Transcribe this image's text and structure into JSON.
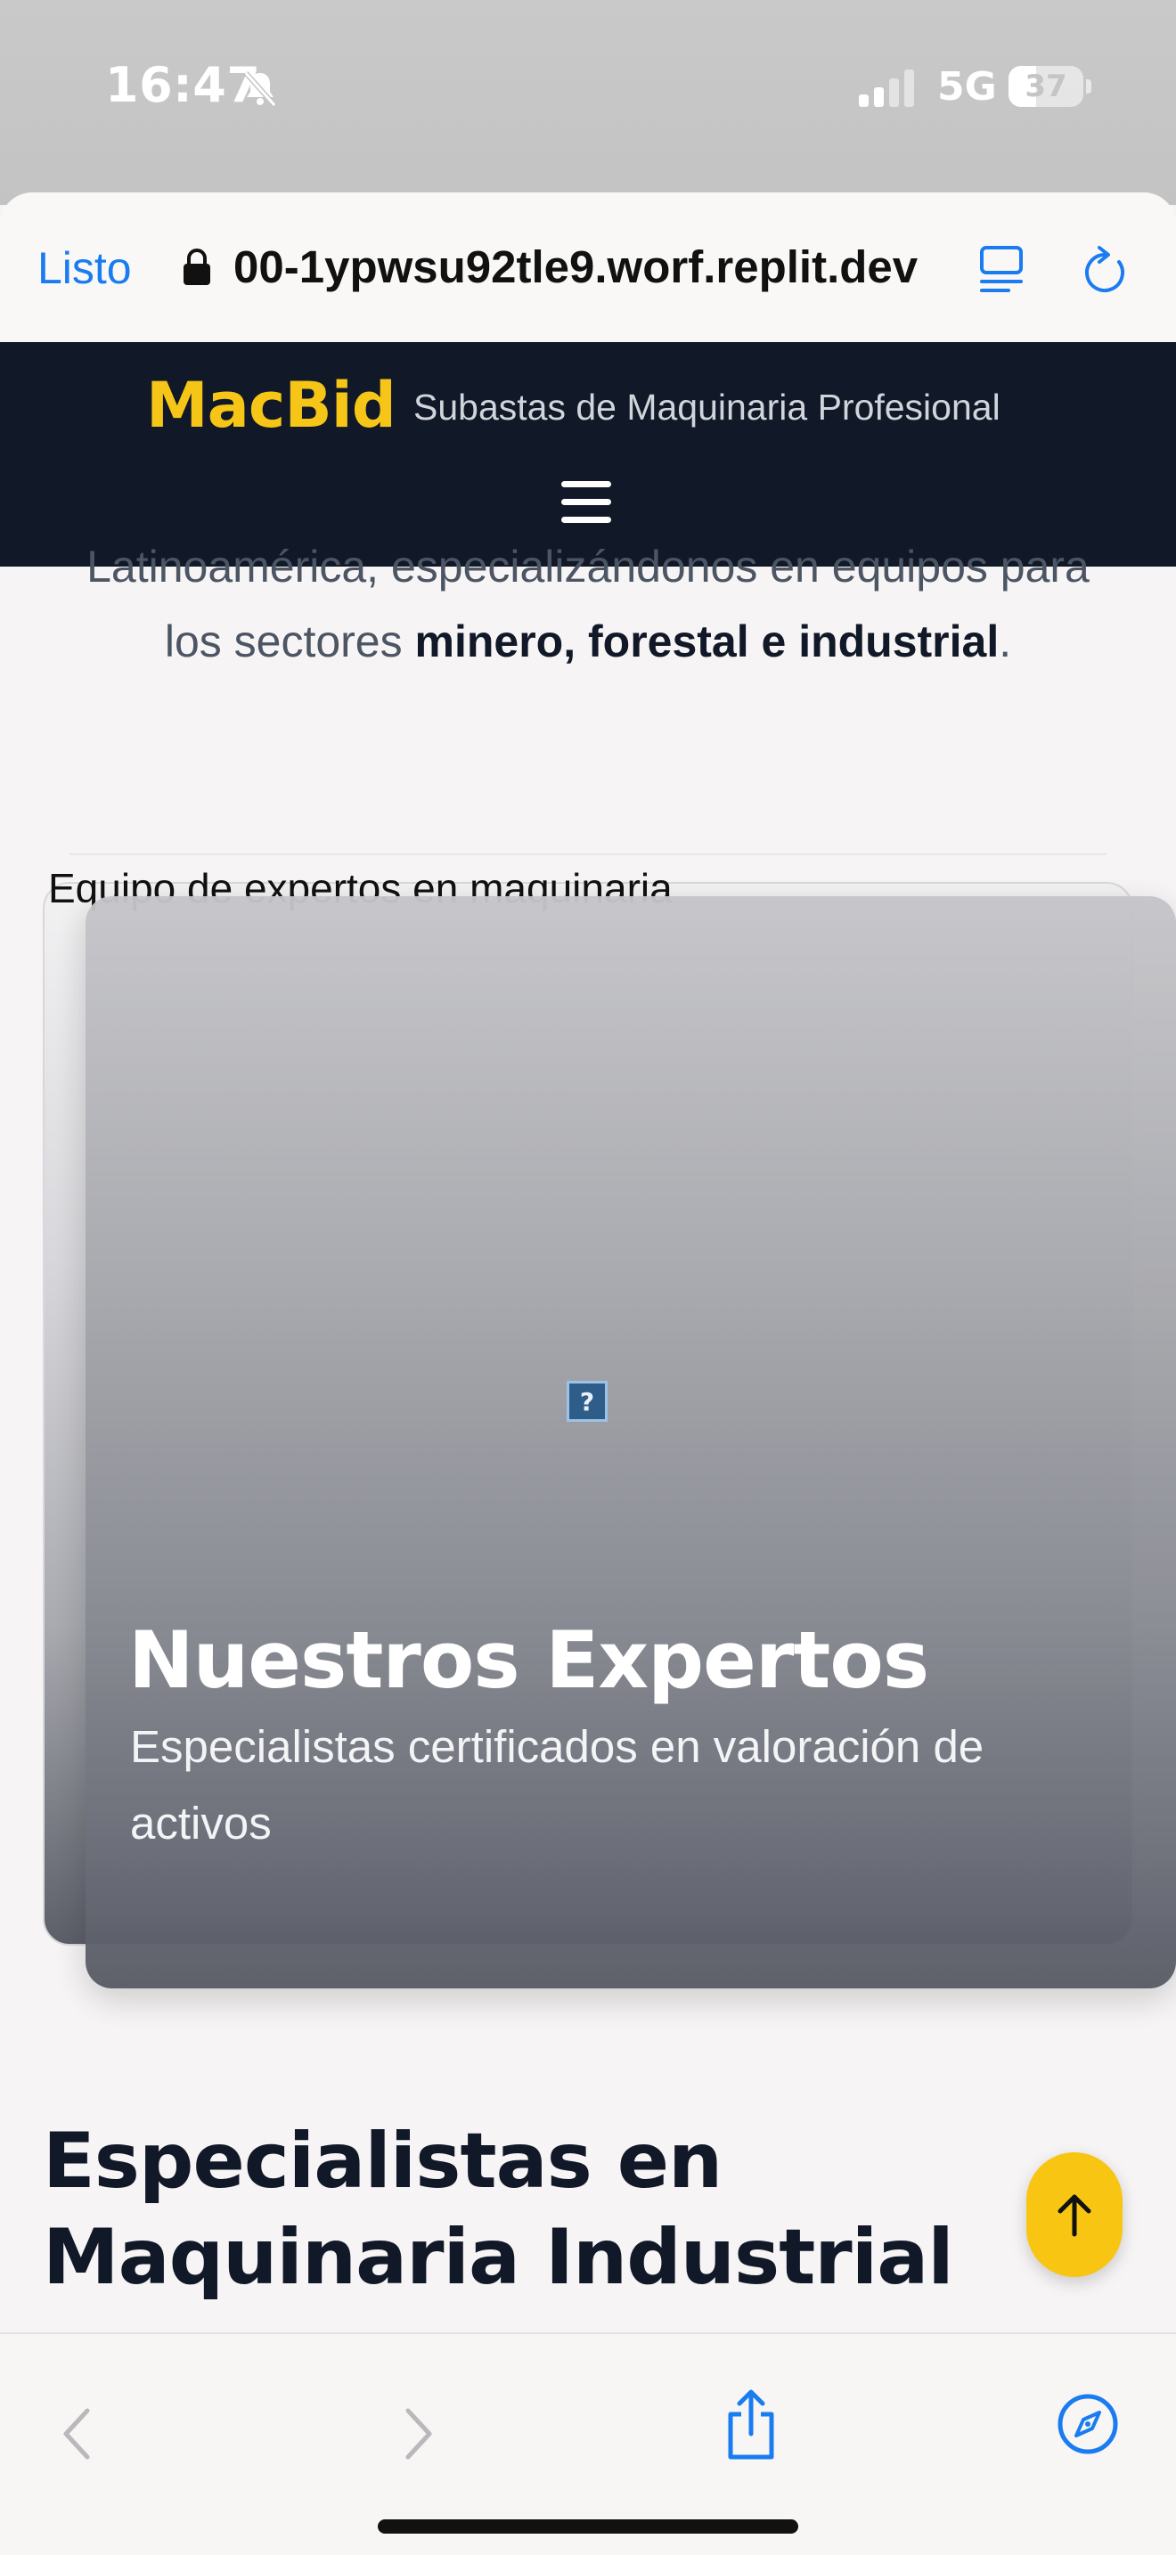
{
  "status_bar": {
    "time": "16:47",
    "network": "5G",
    "battery_percent": "37",
    "battery_level": 0.37,
    "icons": [
      "bell-off-icon",
      "signal-icon",
      "battery-icon"
    ]
  },
  "browser": {
    "done_label": "Listo",
    "url": "00-1ypwsu92tle9.worf.replit.dev",
    "icons": [
      "lock-icon",
      "tabs-icon",
      "reload-icon"
    ],
    "accent_color": "#1a7cf0"
  },
  "site_header": {
    "brand": "MacBid",
    "tagline": "Subastas de Maquinaria Profesional",
    "brand_color": "#f5c518",
    "background_color": "#111827"
  },
  "intro": {
    "line1_partial": "Latinoamérica, especializándonos en equipos para",
    "line2_prefix": "los sectores ",
    "line2_bold": "minero, forestal e industrial",
    "line2_suffix": "."
  },
  "image_card": {
    "alt_text": "Equipo de expertos en maquinaria",
    "broken_image_glyph": "?",
    "title": "Nuestros Expertos",
    "subtitle": "Especialistas certificados en valoración de activos"
  },
  "section": {
    "heading": "Especialistas en Maquinaria Industrial"
  },
  "scroll_top": {
    "icon": "arrow-up-icon",
    "color": "#f8c512"
  },
  "bottom_toolbar": {
    "icons": [
      "back-icon",
      "forward-icon",
      "share-icon",
      "compass-icon"
    ]
  }
}
